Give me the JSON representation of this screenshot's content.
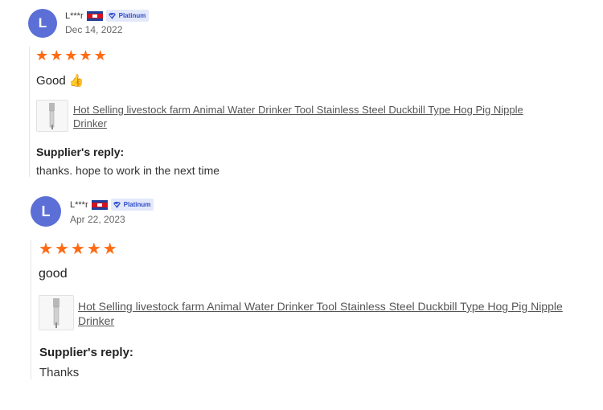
{
  "reviews": [
    {
      "avatar_letter": "L",
      "username": "L***r",
      "country_flag": "cambodia-flag",
      "badge": "Platinum",
      "date": "Dec 14, 2022",
      "rating": 5,
      "comment": "Good",
      "comment_emoji": "👍",
      "product_title": "Hot Selling livestock farm Animal Water Drinker Tool Stainless Steel Duckbill Type Hog Pig Nipple Drinker",
      "reply_label": "Supplier's reply:",
      "reply_text": "thanks. hope to work in the next time"
    },
    {
      "avatar_letter": "L",
      "username": "L***r",
      "country_flag": "cambodia-flag",
      "badge": "Platinum",
      "date": "Apr 22, 2023",
      "rating": 5,
      "comment": "good",
      "product_title": "Hot Selling livestock farm Animal Water Drinker Tool Stainless Steel Duckbill Type Hog Pig Nipple Drinker",
      "reply_label": "Supplier's reply:",
      "reply_text": "Thanks"
    }
  ],
  "colors": {
    "star": "#ff6a13",
    "avatar": "#5b6fd6",
    "badge_bg": "#e3e9fb",
    "badge_text": "#2d4ac4"
  }
}
